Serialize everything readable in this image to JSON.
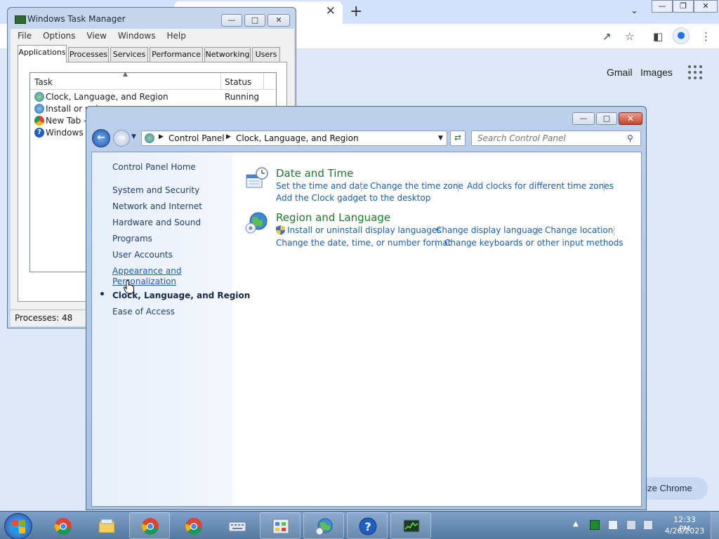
{
  "chrome": {
    "gmail": "Gmail",
    "images": "Images",
    "customize": "nize Chrome"
  },
  "task_manager": {
    "title": "Windows Task Manager",
    "menu": [
      "File",
      "Options",
      "View",
      "Windows",
      "Help"
    ],
    "tabs": [
      "Applications",
      "Processes",
      "Services",
      "Performance",
      "Networking",
      "Users"
    ],
    "columns": {
      "task": "Task",
      "status": "Status"
    },
    "rows": [
      {
        "name": "Clock, Language, and Region",
        "status": "Running",
        "icon": "control-panel-icon"
      },
      {
        "name": "Install or uni",
        "status": "",
        "icon": "globe-icon"
      },
      {
        "name": "New Tab - G",
        "status": "",
        "icon": "chrome-icon"
      },
      {
        "name": "Windows He",
        "status": "",
        "icon": "help-icon"
      }
    ],
    "processes": "Processes: 48"
  },
  "control_panel": {
    "breadcrumb": [
      "Control Panel",
      "Clock, Language, and Region"
    ],
    "search_placeholder": "Search Control Panel",
    "nav": {
      "home": "Control Panel Home",
      "system_security": "System and Security",
      "network_internet": "Network and Internet",
      "hardware_sound": "Hardware and Sound",
      "programs": "Programs",
      "user_accounts": "User Accounts",
      "appearance_line1": "Appearance and",
      "appearance_line2": "Personalization",
      "clock_language": "Clock, Language, and Region",
      "ease_access": "Ease of Access"
    },
    "categories": {
      "date_time": {
        "title": "Date and Time",
        "links": [
          "Set the time and date",
          "Change the time zone",
          "Add clocks for different time zones",
          "Add the Clock gadget to the desktop"
        ]
      },
      "region_language": {
        "title": "Region and Language",
        "links": [
          "Install or uninstall display languages",
          "Change display language",
          "Change location",
          "Change the date, time, or number format",
          "Change keyboards or other input methods"
        ]
      }
    }
  },
  "taskbar": {
    "apps": [
      "start-button",
      "chrome-icon",
      "explorer-icon",
      "chrome-icon",
      "chrome-icon",
      "keyboard-icon",
      "control-panel-icon",
      "globe-icon",
      "help-icon",
      "task-manager-icon"
    ],
    "time": "12:33 PM",
    "date": "4/26/2023"
  }
}
